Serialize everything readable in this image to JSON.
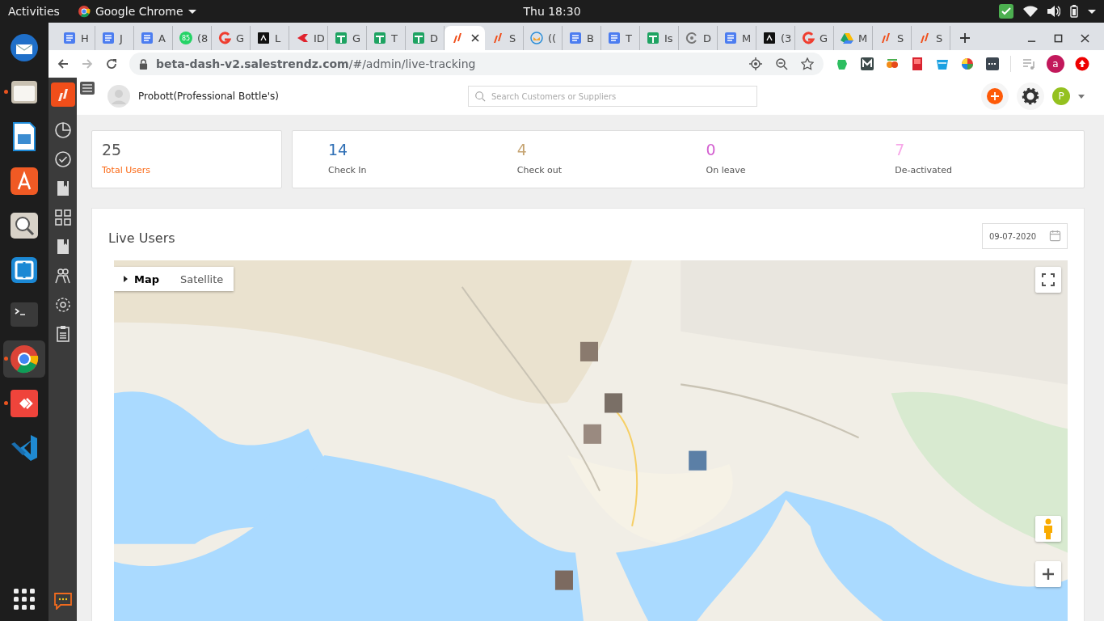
{
  "top_bar": {
    "activities": "Activities",
    "app": "Google Chrome",
    "clock": "Thu 18:30"
  },
  "dock": [
    {
      "kind": "mail",
      "running": false,
      "selected": false
    },
    {
      "kind": "files",
      "running": true,
      "selected": false
    },
    {
      "kind": "writer",
      "running": false,
      "selected": false
    },
    {
      "kind": "store",
      "running": false,
      "selected": false
    },
    {
      "kind": "search",
      "running": false,
      "selected": false
    },
    {
      "kind": "remote",
      "running": false,
      "selected": false
    },
    {
      "kind": "terminal",
      "running": false,
      "selected": false
    },
    {
      "kind": "chrome",
      "running": true,
      "selected": true
    },
    {
      "kind": "anydesk",
      "running": true,
      "selected": false
    },
    {
      "kind": "code",
      "running": false,
      "selected": false
    }
  ],
  "browser": {
    "tabs": [
      {
        "kind": "docs",
        "label": "H",
        "selected": false
      },
      {
        "kind": "docs",
        "label": "J",
        "selected": false
      },
      {
        "kind": "docs",
        "label": "A",
        "selected": false
      },
      {
        "kind": "chat",
        "badge": "85",
        "label": "(8",
        "selected": false
      },
      {
        "kind": "g2",
        "label": "G",
        "selected": false
      },
      {
        "kind": "dark",
        "label": "L",
        "selected": false
      },
      {
        "kind": "flag",
        "label": "ID",
        "selected": false
      },
      {
        "kind": "sheets",
        "label": "G",
        "selected": false
      },
      {
        "kind": "sheets",
        "label": "T",
        "selected": false
      },
      {
        "kind": "sheets",
        "label": "D",
        "selected": false
      },
      {
        "kind": "brand",
        "selected": true
      },
      {
        "kind": "brand",
        "label": "S",
        "selected": false
      },
      {
        "kind": "mail",
        "label": "((",
        "selected": false
      },
      {
        "kind": "docs",
        "label": "B",
        "selected": false
      },
      {
        "kind": "docs",
        "label": "T",
        "selected": false
      },
      {
        "kind": "sheets",
        "label": "Is",
        "selected": false
      },
      {
        "kind": "ring",
        "label": "D",
        "selected": false
      },
      {
        "kind": "docs",
        "label": "M",
        "selected": false
      },
      {
        "kind": "dark",
        "label": "(3",
        "selected": false
      },
      {
        "kind": "g2",
        "label": "G",
        "selected": false
      },
      {
        "kind": "drive",
        "label": "M",
        "selected": false
      },
      {
        "kind": "brand",
        "label": "S",
        "selected": false
      },
      {
        "kind": "brand",
        "label": "S",
        "selected": false
      }
    ],
    "address": "**beta-dash-v2.salestrendz.com**/#/admin/live-tracking",
    "extensions": [
      {
        "kind": "elephant"
      },
      {
        "kind": "m"
      },
      {
        "kind": "sq"
      },
      {
        "kind": "book"
      },
      {
        "kind": "bucket"
      },
      {
        "kind": "wheel"
      },
      {
        "kind": "dots"
      }
    ],
    "profile": "a"
  },
  "app": {
    "nav": [
      {
        "kind": "chart",
        "selected": false
      },
      {
        "kind": "check",
        "selected": false
      },
      {
        "kind": "book",
        "selected": false
      },
      {
        "kind": "grid",
        "selected": false
      },
      {
        "kind": "book",
        "selected": false
      },
      {
        "kind": "people",
        "selected": false
      },
      {
        "kind": "gear",
        "selected": false
      },
      {
        "kind": "clipboard",
        "selected": false
      }
    ],
    "company": "Probott(Professional Bottle's)",
    "search": {
      "placeholder": "Search Customers or Suppliers"
    },
    "avatar": "P",
    "total": {
      "value": "25",
      "label": "Total Users"
    },
    "stats": [
      {
        "value": "14",
        "label": "Check In",
        "color": "#2f6fb5"
      },
      {
        "value": "4",
        "label": "Check out",
        "color": "#c6a472"
      },
      {
        "value": "0",
        "label": "On leave",
        "color": "#d35fd0"
      },
      {
        "value": "7",
        "label": "De-activated",
        "color": "#f7a7e8"
      }
    ],
    "live": {
      "title": "Live Users",
      "date": "09-07-2020",
      "map_types": [
        {
          "label": "Map",
          "selected": true
        },
        {
          "label": "Satellite",
          "selected": false
        }
      ]
    }
  }
}
